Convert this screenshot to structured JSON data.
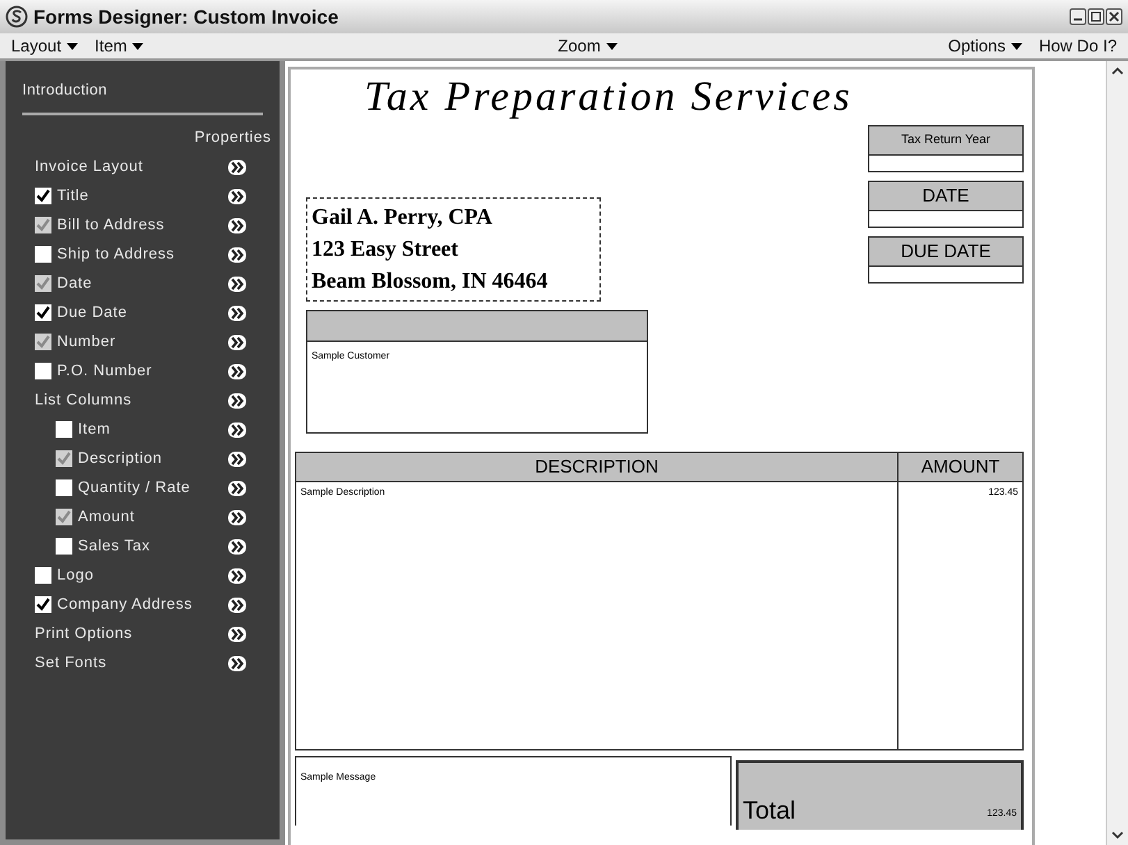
{
  "window": {
    "title": "Forms Designer:  Custom Invoice"
  },
  "menu": {
    "left": [
      "Layout",
      "Item"
    ],
    "center": [
      "Zoom"
    ],
    "right": [
      {
        "label": "Options",
        "dropdown": true
      },
      {
        "label": "How Do I?",
        "dropdown": false
      }
    ]
  },
  "sidebar": {
    "intro": "Introduction",
    "column_header": "Properties",
    "items": [
      {
        "kind": "plain",
        "label": "Invoice Layout"
      },
      {
        "kind": "checkbox",
        "label": "Title",
        "checked": true,
        "disabled": false
      },
      {
        "kind": "checkbox",
        "label": "Bill to Address",
        "checked": true,
        "disabled": true
      },
      {
        "kind": "checkbox",
        "label": "Ship to Address",
        "checked": false,
        "disabled": false
      },
      {
        "kind": "checkbox",
        "label": "Date",
        "checked": true,
        "disabled": true
      },
      {
        "kind": "checkbox",
        "label": "Due Date",
        "checked": true,
        "disabled": false
      },
      {
        "kind": "checkbox",
        "label": "Number",
        "checked": true,
        "disabled": true
      },
      {
        "kind": "checkbox",
        "label": "P.O. Number",
        "checked": false,
        "disabled": false
      },
      {
        "kind": "plain",
        "label": "List Columns",
        "children": [
          {
            "kind": "checkbox",
            "label": "Item",
            "checked": false,
            "disabled": false
          },
          {
            "kind": "checkbox",
            "label": "Description",
            "checked": true,
            "disabled": true
          },
          {
            "kind": "checkbox",
            "label": "Quantity / Rate",
            "checked": false,
            "disabled": false
          },
          {
            "kind": "checkbox",
            "label": "Amount",
            "checked": true,
            "disabled": true
          },
          {
            "kind": "checkbox",
            "label": "Sales Tax",
            "checked": false,
            "disabled": false
          }
        ]
      },
      {
        "kind": "checkbox",
        "label": "Logo",
        "checked": false,
        "disabled": false
      },
      {
        "kind": "checkbox",
        "label": "Company Address",
        "checked": true,
        "disabled": false
      },
      {
        "kind": "plain",
        "label": "Print Options"
      },
      {
        "kind": "plain",
        "label": "Set Fonts"
      }
    ]
  },
  "invoice": {
    "title": "Tax Preparation Services",
    "fields": [
      "Tax Return Year",
      "DATE",
      "DUE DATE"
    ],
    "company_address": [
      "Gail A. Perry, CPA",
      "123 Easy Street",
      "Beam Blossom, IN 46464"
    ],
    "customer": "Sample Customer",
    "table": {
      "columns": [
        "DESCRIPTION",
        "AMOUNT"
      ],
      "rows": [
        [
          "Sample Description",
          "123.45"
        ]
      ]
    },
    "message": "Sample Message",
    "total": {
      "label": "Total",
      "value": "123.45"
    }
  }
}
